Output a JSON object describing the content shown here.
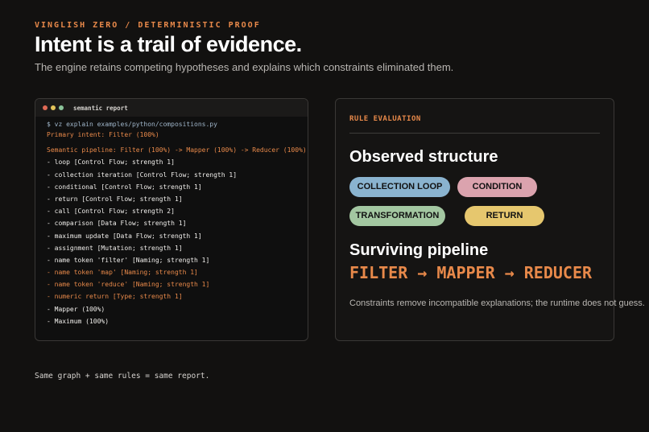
{
  "header": {
    "eyebrow": "VINGLISH ZERO / DETERMINISTIC PROOF",
    "title": "Intent is a trail of evidence.",
    "subtitle": "The engine retains competing hypotheses and explains which constraints eliminated them."
  },
  "terminal": {
    "title": "semantic report",
    "lines": [
      {
        "text": "$ vz explain examples/python/compositions.py",
        "style": "cmd"
      },
      {
        "text": "Primary intent: Filter (100%)",
        "style": "accent"
      },
      {
        "text": "Semantic pipeline: Filter (100%) -> Mapper (100%) -> Reducer (100%)",
        "style": "accent"
      },
      {
        "text": "- loop [Control Flow; strength 1]",
        "style": "plain"
      },
      {
        "text": "- collection iteration [Control Flow; strength 1]",
        "style": "plain"
      },
      {
        "text": "- conditional [Control Flow; strength 1]",
        "style": "plain"
      },
      {
        "text": "- return [Control Flow; strength 1]",
        "style": "plain"
      },
      {
        "text": "- call [Control Flow; strength 2]",
        "style": "plain"
      },
      {
        "text": "- comparison [Data Flow; strength 1]",
        "style": "plain"
      },
      {
        "text": "- maximum update [Data Flow; strength 1]",
        "style": "plain"
      },
      {
        "text": "- assignment [Mutation; strength 1]",
        "style": "plain"
      },
      {
        "text": "- name token 'filter' [Naming; strength 1]",
        "style": "plain"
      },
      {
        "text": "- name token 'map' [Naming; strength 1]",
        "style": "accent"
      },
      {
        "text": "- name token 'reduce' [Naming; strength 1]",
        "style": "accent"
      },
      {
        "text": "- numeric return [Type; strength 1]",
        "style": "accent"
      },
      {
        "text": "- Mapper (100%)",
        "style": "plain"
      },
      {
        "text": "- Maximum (100%)",
        "style": "plain"
      }
    ]
  },
  "rule_panel": {
    "heading": "RULE EVALUATION",
    "observed_title": "Observed structure",
    "pills": {
      "collection_loop": "COLLECTION LOOP",
      "condition": "CONDITION",
      "transformation": "TRANSFORMATION",
      "return": "RETURN"
    },
    "pill_colors": {
      "collection_loop": "#8ab3cf",
      "condition": "#dba3ae",
      "transformation": "#a3c7a1",
      "return": "#e6c76e"
    },
    "surviving_title": "Surviving pipeline",
    "pipeline": "FILTER → MAPPER → REDUCER",
    "note": "Constraints remove incompatible explanations; the runtime does not guess."
  },
  "footer": {
    "text": "Same graph + same rules = same report."
  },
  "colors": {
    "background": "#121110",
    "accent": "#e8894a",
    "command": "#9fb5c9"
  }
}
